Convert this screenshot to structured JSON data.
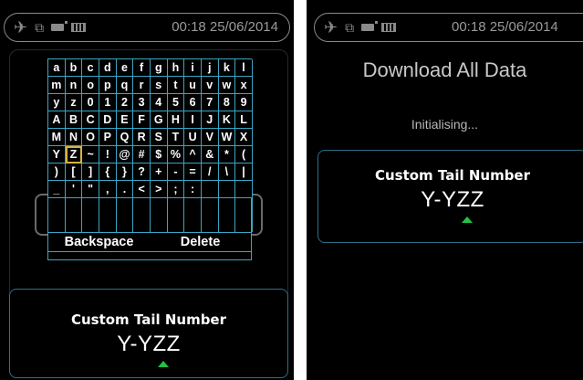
{
  "left_screen": {
    "status_bar": {
      "time": "00:18 25/06/2014",
      "icons": [
        "plane-icon",
        "network-icon",
        "usb-icon",
        "battery-icon"
      ]
    },
    "keyboard": {
      "rows": [
        [
          "a",
          "b",
          "c",
          "d",
          "e",
          "f",
          "g",
          "h",
          "i",
          "j",
          "k",
          "l"
        ],
        [
          "m",
          "n",
          "o",
          "p",
          "q",
          "r",
          "s",
          "t",
          "u",
          "v",
          "w",
          "x"
        ],
        [
          "y",
          "z",
          "0",
          "1",
          "2",
          "3",
          "4",
          "5",
          "6",
          "7",
          "8",
          "9"
        ],
        [
          "A",
          "B",
          "C",
          "D",
          "E",
          "F",
          "G",
          "H",
          "I",
          "J",
          "K",
          "L"
        ],
        [
          "M",
          "N",
          "O",
          "P",
          "Q",
          "R",
          "S",
          "T",
          "U",
          "V",
          "W",
          "X"
        ],
        [
          "Y",
          "Z",
          "~",
          "!",
          "@",
          "#",
          "$",
          "%",
          "^",
          "&",
          "*",
          "("
        ],
        [
          ")",
          "[",
          "]",
          "{",
          "}",
          "?",
          "+",
          "-",
          "=",
          "/",
          "\\",
          "|"
        ],
        [
          "_",
          "'",
          "\"",
          ",",
          ".",
          "<",
          ">",
          ";",
          ":",
          "",
          "",
          ""
        ]
      ],
      "selected_key": "Z",
      "backspace_label": "Backspace",
      "delete_label": "Delete"
    },
    "tail_number": {
      "label": "Custom Tail Number",
      "value": "Y-YZZ"
    }
  },
  "right_screen": {
    "status_bar": {
      "time": "00:18 25/06/2014",
      "icons": [
        "plane-icon",
        "network-icon",
        "usb-icon",
        "battery-icon"
      ]
    },
    "title": "Download All Data",
    "status_text": "Initialising...",
    "tail_number": {
      "label": "Custom Tail Number",
      "value": "Y-YZZ"
    }
  },
  "colors": {
    "background": "#000000",
    "grid_line": "#3aa6c2",
    "panel_border": "#2f6f88",
    "caret": "#22c14a",
    "selected_key": "#d9b340"
  }
}
